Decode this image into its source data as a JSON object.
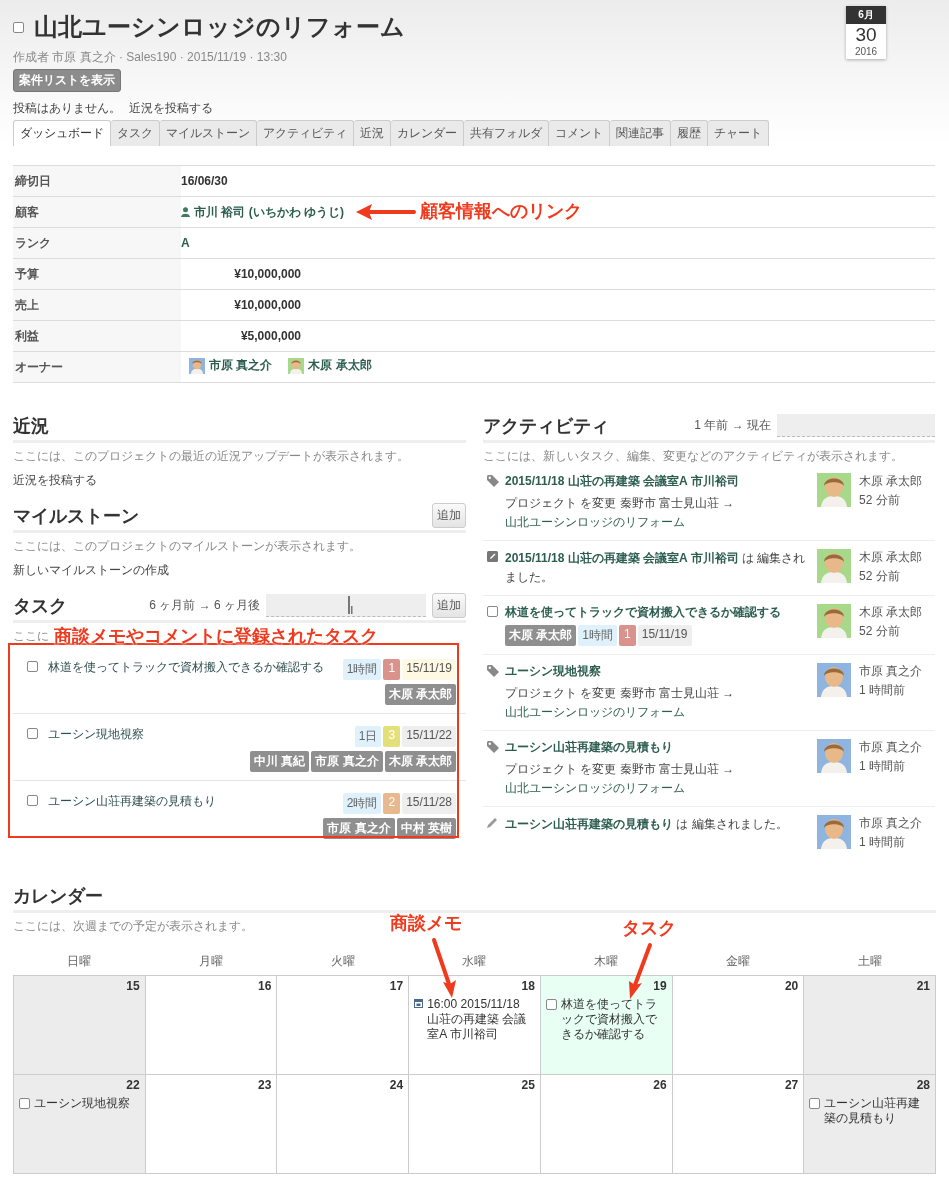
{
  "header": {
    "checked": false,
    "title": "山北ユーシンロッジのリフォーム",
    "meta": "作成者 市原 真之介 · Sales190 · 2015/11/19 · 13:30",
    "list_button": "案件リストを表示",
    "posts_text": "投稿はありません。",
    "post_link": "近況を投稿する"
  },
  "date_badge": {
    "month": "6月",
    "day": "30",
    "year": "2016"
  },
  "tabs": [
    {
      "label": "ダッシュボード",
      "selected": true
    },
    {
      "label": "タスク",
      "selected": false
    },
    {
      "label": "マイルストーン",
      "selected": false
    },
    {
      "label": "アクティビティ",
      "selected": false
    },
    {
      "label": "近況",
      "selected": false
    },
    {
      "label": "カレンダー",
      "selected": false
    },
    {
      "label": "共有フォルダ",
      "selected": false
    },
    {
      "label": "コメント",
      "selected": false
    },
    {
      "label": "関連記事",
      "selected": false
    },
    {
      "label": "履歴",
      "selected": false
    },
    {
      "label": "チャート",
      "selected": false
    }
  ],
  "details": [
    {
      "label": "締切日",
      "kind": "text",
      "value": "16/06/30"
    },
    {
      "label": "顧客",
      "kind": "contact",
      "value": "市川 裕司 (いちかわ ゆうじ)"
    },
    {
      "label": "ランク",
      "kind": "rank",
      "value": "A"
    },
    {
      "label": "予算",
      "kind": "money",
      "value": "¥10,000,000"
    },
    {
      "label": "売上",
      "kind": "money",
      "value": "¥10,000,000"
    },
    {
      "label": "利益",
      "kind": "money",
      "value": "¥5,000,000"
    },
    {
      "label": "オーナー",
      "kind": "people",
      "people": [
        {
          "name": "市原 真之介",
          "color": "#8fb4e0"
        },
        {
          "name": "木原 承太郎",
          "color": "#a8d88a"
        }
      ]
    }
  ],
  "news": {
    "title": "近況",
    "description": "ここには、このプロジェクトの最近の近況アップデートが表示されます。",
    "link": "近況を投稿する"
  },
  "milestones": {
    "title": "マイルストーン",
    "add_button": "追加",
    "description": "ここには、このプロジェクトのマイルストーンが表示されます。",
    "link": "新しいマイルストーンの作成"
  },
  "tasks": {
    "title": "タスク",
    "range_label": "6 ヶ月前 → 6 ヶ月後",
    "add_button": "追加",
    "description": "ここに",
    "items": [
      {
        "checked": false,
        "title": "林道を使ってトラックで資材搬入できるか確認する",
        "duration": "1時間",
        "priority": "1",
        "color": "#d9928c",
        "date": "15/11/19",
        "due_soon": true,
        "assignees": [
          "木原 承太郎"
        ]
      },
      {
        "checked": false,
        "title": "ユーシン現地視察",
        "duration": "1日",
        "priority": "3",
        "color": "#e3e07a",
        "date": "15/11/22",
        "due_soon": false,
        "assignees": [
          "中川 真紀",
          "市原 真之介",
          "木原 承太郎"
        ]
      },
      {
        "checked": false,
        "title": "ユーシン山荘再建築の見積もり",
        "duration": "2時間",
        "priority": "2",
        "color": "#e8b88e",
        "date": "15/11/28",
        "due_soon": false,
        "assignees": [
          "市原 真之介",
          "中村 英樹"
        ]
      }
    ]
  },
  "activity": {
    "title": "アクティビティ",
    "range_label": "1 年前 → 現在",
    "description": "ここには、新しいタスク、編集、変更などのアクティビティが表示されます。",
    "items": [
      {
        "kind": "tag",
        "title": "2015/11/18 山荘の再建築 会議室A 市川裕司",
        "detail": "プロジェクト を変更 秦野市 富士見山荘 →",
        "detail_link": "山北ユーシンロッジのリフォーム",
        "user": "木原 承太郎",
        "time": "52 分前",
        "color": "#a8d88a"
      },
      {
        "kind": "note",
        "title": "2015/11/18 山荘の再建築 会議室A 市川裕司",
        "suffix": "は 編集されました。",
        "user": "木原 承太郎",
        "time": "52 分前",
        "color": "#a8d88a"
      },
      {
        "kind": "task",
        "checked": false,
        "title": "林道を使ってトラックで資材搬入できるか確認する",
        "assignee": "木原 承太郎",
        "duration": "1時間",
        "priority": {
          "label": "1",
          "color": "#d9928c"
        },
        "date": "15/11/19",
        "user": "木原 承太郎",
        "time": "52 分前",
        "color": "#a8d88a"
      },
      {
        "kind": "tag",
        "title": "ユーシン現地視察",
        "detail": "プロジェクト を変更 秦野市 富士見山荘 →",
        "detail_link": "山北ユーシンロッジのリフォーム",
        "user": "市原 真之介",
        "time": "1 時間前",
        "color": "#8fb4e0"
      },
      {
        "kind": "tag",
        "title": "ユーシン山荘再建築の見積もり",
        "detail": "プロジェクト を変更 秦野市 富士見山荘 →",
        "detail_link": "山北ユーシンロッジのリフォーム",
        "user": "市原 真之介",
        "time": "1 時間前",
        "color": "#8fb4e0"
      },
      {
        "kind": "pencil",
        "title": "ユーシン山荘再建築の見積もり",
        "suffix": "は 編集されました。",
        "user": "市原 真之介",
        "time": "1 時間前",
        "color": "#8fb4e0"
      }
    ]
  },
  "calendar": {
    "title": "カレンダー",
    "description": "ここには、次週までの予定が表示されます。",
    "weekdays": [
      "日曜",
      "月曜",
      "火曜",
      "水曜",
      "木曜",
      "金曜",
      "土曜"
    ],
    "weeks": [
      [
        {
          "day": "15",
          "weekend": true,
          "highlighted": false
        },
        {
          "day": "16",
          "weekend": false,
          "highlighted": false
        },
        {
          "day": "17",
          "weekend": false,
          "highlighted": false
        },
        {
          "day": "18",
          "weekend": false,
          "highlighted": false,
          "events": [
            {
              "kind": "memo",
              "text": "16:00 2015/11/18 山荘の再建築 会議室A 市川裕司"
            }
          ]
        },
        {
          "day": "19",
          "weekend": false,
          "highlighted": true,
          "events": [
            {
              "kind": "task",
              "checked": false,
              "text": "林道を使ってトラックで資材搬入できるか確認する"
            }
          ]
        },
        {
          "day": "20",
          "weekend": false,
          "highlighted": false
        },
        {
          "day": "21",
          "weekend": true,
          "highlighted": false
        }
      ],
      [
        {
          "day": "22",
          "weekend": true,
          "highlighted": false,
          "events": [
            {
              "kind": "task",
              "checked": false,
              "text": "ユーシン現地視察"
            }
          ]
        },
        {
          "day": "23",
          "weekend": false,
          "highlighted": false
        },
        {
          "day": "24",
          "weekend": false,
          "highlighted": false
        },
        {
          "day": "25",
          "weekend": false,
          "highlighted": false
        },
        {
          "day": "26",
          "weekend": false,
          "highlighted": false
        },
        {
          "day": "27",
          "weekend": false,
          "highlighted": false
        },
        {
          "day": "28",
          "weekend": true,
          "highlighted": false,
          "events": [
            {
              "kind": "task",
              "checked": false,
              "text": "ユーシン山荘再建築の見積もり"
            }
          ]
        }
      ]
    ]
  },
  "callouts": [
    {
      "text": "顧客情報へのリンク"
    },
    {
      "text": "商談メモやコメントに登録されたタスク"
    },
    {
      "text": "商談メモ"
    },
    {
      "text": "タスク"
    }
  ]
}
